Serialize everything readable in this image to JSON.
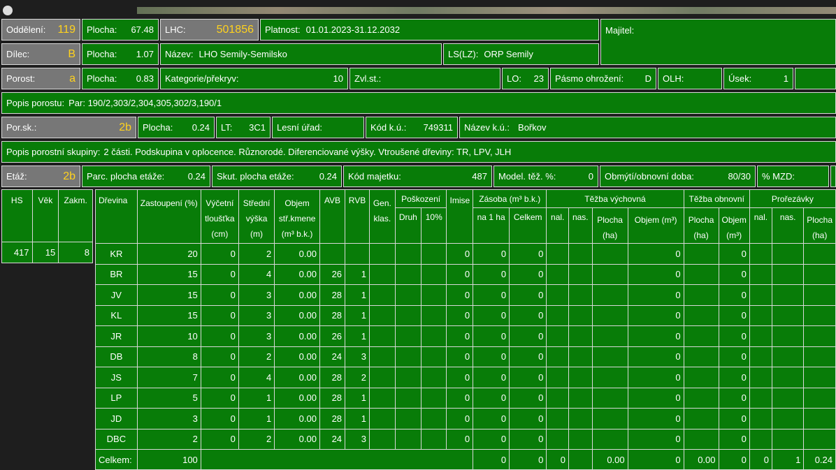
{
  "r1": {
    "oddeleni_label": "Oddělení:",
    "oddeleni": "119",
    "plocha_label": "Plocha:",
    "plocha": "67.48",
    "lhc_label": "LHC:",
    "lhc": "501856",
    "platnost_label": "Platnost:",
    "platnost": "01.01.2023-31.12.2032",
    "majitel_label": "Majitel:",
    "majitel": ""
  },
  "r2": {
    "dilec_label": "Dílec:",
    "dilec": "B",
    "plocha_label": "Plocha:",
    "plocha": "1.07",
    "nazev_label": "Název:",
    "nazev": "LHO Semily-Semilsko",
    "ls_label": "LS(LZ):",
    "ls": "ORP Semily"
  },
  "r3": {
    "porost_label": "Porost:",
    "porost": "a",
    "plocha_label": "Plocha:",
    "plocha": "0.83",
    "kategorie_label": "Kategorie/překryv:",
    "kategorie": "10",
    "zvlst_label": "Zvl.st.:",
    "zvlst": "",
    "lo_label": "LO:",
    "lo": "23",
    "pasmo_label": "Pásmo ohrožení:",
    "pasmo": "D",
    "olh_label": "OLH:",
    "olh": "",
    "usek_label": "Úsek:",
    "usek": "1"
  },
  "r4": {
    "popis_label": "Popis porostu:",
    "popis": "Par: 190/2,303/2,304,305,302/3,190/1"
  },
  "r5": {
    "porsk_label": "Por.sk.:",
    "porsk": "2b",
    "plocha_label": "Plocha:",
    "plocha": "0.24",
    "lt_label": "LT:",
    "lt": "3C1",
    "lesni_label": "Lesní úřad:",
    "lesni": "",
    "kodku_label": "Kód k.ú.:",
    "kodku": "749311",
    "nazevku_label": "Název k.ú.:",
    "nazevku": "Bořkov"
  },
  "r6": {
    "popis_label": "Popis porostní skupiny:",
    "popis": "2 části. Podskupina v oplocence. Různorodé. Diferenciované výšky. Vtroušené dřeviny: TR, LPV, JLH"
  },
  "r7": {
    "etaz_label": "Etáž:",
    "etaz": "2b",
    "parc_label": "Parc. plocha etáže:",
    "parc": "0.24",
    "skut_label": "Skut. plocha etáže:",
    "skut": "0.24",
    "kodmaj_label": "Kód majetku:",
    "kodmaj": "487",
    "model_label": "Model. těž. %:",
    "model": "0",
    "obmyti_label": "Obmýtí/obnovní doba:",
    "obmyti": "80/30",
    "mzd_label": "% MZD:",
    "mzd": ""
  },
  "hs_table": {
    "headers": [
      "HS",
      "Věk",
      "Zakm."
    ],
    "values": [
      "417",
      "15",
      "8"
    ]
  },
  "species_table": {
    "headers": {
      "drevina": "Dřevina",
      "zastoupeni": "Zastoupení (%)",
      "vycetni": "Výčetní tloušťka (cm)",
      "stredni": "Střední výška (m)",
      "objem": "Objem stř.kmene (m³ b.k.)",
      "avb": "AVB",
      "rvb": "RVB",
      "gen": "Gen. klas.",
      "poskozeni": "Poškození",
      "druh": "Druh",
      "pct10": "10%",
      "imise": "Imise",
      "zasoba": "Zásoba (m³ b.k.)",
      "na1ha": "na 1 ha",
      "celkem": "Celkem",
      "tezba_vych": "Těžba výchovná",
      "nal": "nal.",
      "nas": "nas.",
      "plocha_ha": "Plocha (ha)",
      "objem_m3": "Objem (m³)",
      "tezba_obn": "Těžba obnovní",
      "prorezavky": "Prořezávky"
    },
    "rows": [
      {
        "drevina": "KR",
        "zast": "20",
        "tl": "0",
        "vy": "2",
        "obj": "0.00",
        "avb": "",
        "rvb": "",
        "imise": "0",
        "na1ha": "0",
        "celkem": "0",
        "tv_obj": "0",
        "to_obj": "0"
      },
      {
        "drevina": "BR",
        "zast": "15",
        "tl": "0",
        "vy": "4",
        "obj": "0.00",
        "avb": "26",
        "rvb": "1",
        "imise": "0",
        "na1ha": "0",
        "celkem": "0",
        "tv_obj": "0",
        "to_obj": "0"
      },
      {
        "drevina": "JV",
        "zast": "15",
        "tl": "0",
        "vy": "3",
        "obj": "0.00",
        "avb": "28",
        "rvb": "1",
        "imise": "0",
        "na1ha": "0",
        "celkem": "0",
        "tv_obj": "0",
        "to_obj": "0"
      },
      {
        "drevina": "KL",
        "zast": "15",
        "tl": "0",
        "vy": "3",
        "obj": "0.00",
        "avb": "28",
        "rvb": "1",
        "imise": "0",
        "na1ha": "0",
        "celkem": "0",
        "tv_obj": "0",
        "to_obj": "0"
      },
      {
        "drevina": "JR",
        "zast": "10",
        "tl": "0",
        "vy": "3",
        "obj": "0.00",
        "avb": "26",
        "rvb": "1",
        "imise": "0",
        "na1ha": "0",
        "celkem": "0",
        "tv_obj": "0",
        "to_obj": "0"
      },
      {
        "drevina": "DB",
        "zast": "8",
        "tl": "0",
        "vy": "2",
        "obj": "0.00",
        "avb": "24",
        "rvb": "3",
        "imise": "0",
        "na1ha": "0",
        "celkem": "0",
        "tv_obj": "0",
        "to_obj": "0"
      },
      {
        "drevina": "JS",
        "zast": "7",
        "tl": "0",
        "vy": "4",
        "obj": "0.00",
        "avb": "28",
        "rvb": "2",
        "imise": "0",
        "na1ha": "0",
        "celkem": "0",
        "tv_obj": "0",
        "to_obj": "0"
      },
      {
        "drevina": "LP",
        "zast": "5",
        "tl": "0",
        "vy": "1",
        "obj": "0.00",
        "avb": "28",
        "rvb": "1",
        "imise": "0",
        "na1ha": "0",
        "celkem": "0",
        "tv_obj": "0",
        "to_obj": "0"
      },
      {
        "drevina": "JD",
        "zast": "3",
        "tl": "0",
        "vy": "1",
        "obj": "0.00",
        "avb": "28",
        "rvb": "1",
        "imise": "0",
        "na1ha": "0",
        "celkem": "0",
        "tv_obj": "0",
        "to_obj": "0"
      },
      {
        "drevina": "DBC",
        "zast": "2",
        "tl": "0",
        "vy": "2",
        "obj": "0.00",
        "avb": "24",
        "rvb": "3",
        "imise": "0",
        "na1ha": "0",
        "celkem": "0",
        "tv_obj": "0",
        "to_obj": "0"
      }
    ],
    "total": {
      "label": "Celkem:",
      "zast": "100",
      "na1ha": "0",
      "celkem": "0",
      "tv_nal": "0",
      "tv_plocha": "0.00",
      "tv_obj": "0",
      "to_plocha": "0.00",
      "to_obj": "0",
      "pr_nal": "0",
      "pr_nas": "1",
      "pr_plocha": "0.24"
    }
  },
  "colors": {
    "cell_green": "#087c08",
    "cell_gray": "#777777",
    "highlight_yellow": "#ffd21e",
    "background": "#1e1e1e"
  }
}
